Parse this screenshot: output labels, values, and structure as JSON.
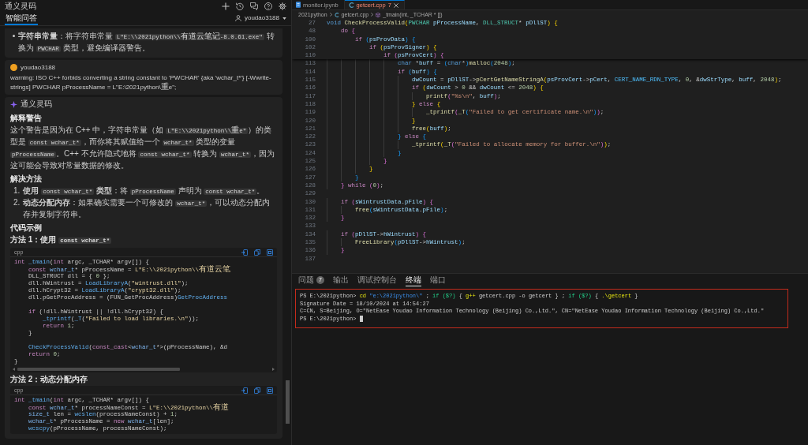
{
  "side_panel": {
    "title": "通义灵码",
    "tab": {
      "label": "智能问答",
      "selected": true
    },
    "user": "youdao3188"
  },
  "chat": [
    {
      "kind": "answer_tail",
      "blocks": [
        {
          "kind": "bullet",
          "segments": [
            {
              "kind": "bold",
              "text": "字符串常量"
            },
            {
              "kind": "text",
              "text": "：将字符串常量 "
            },
            {
              "kind": "code",
              "text": "L\"E:\\\\2021python\\\\有道云笔记-8.0.61.exe\""
            },
            {
              "kind": "text",
              "text": " 转换为 "
            },
            {
              "kind": "code",
              "text": "PWCHAR"
            },
            {
              "kind": "text",
              "text": " 类型，避免编译器警告。"
            }
          ]
        }
      ]
    },
    {
      "kind": "user",
      "author": "youdao3188",
      "text": "warning: ISO C++ forbids converting a string constant to 'PWCHAR' {aka 'wchar_t*'} [-Wwrite-strings] PWCHAR pProcessName = L\"E:\\2021python\\重e\";"
    },
    {
      "kind": "assistant",
      "author": "通义灵码",
      "blocks": [
        {
          "kind": "heading",
          "text": "解释警告"
        },
        {
          "kind": "paragraph",
          "segments": [
            {
              "kind": "text",
              "text": "这个警告是因为在 C++ 中，字符串常量（如 "
            },
            {
              "kind": "code",
              "text": "L\"E:\\\\2021python\\\\重e\""
            },
            {
              "kind": "text",
              "text": "）的类型是 "
            },
            {
              "kind": "code",
              "text": "const wchar_t*"
            },
            {
              "kind": "text",
              "text": "，而你将其赋值给一个 "
            },
            {
              "kind": "code",
              "text": "wchar_t*"
            },
            {
              "kind": "text",
              "text": " 类型的变量 "
            },
            {
              "kind": "code",
              "text": "pProcessName"
            },
            {
              "kind": "text",
              "text": "。C++ 不允许隐式地将 "
            },
            {
              "kind": "code",
              "text": "const wchar_t*"
            },
            {
              "kind": "text",
              "text": " 转换为 "
            },
            {
              "kind": "code",
              "text": "wchar_t*"
            },
            {
              "kind": "text",
              "text": "，因为这可能会导致对常量数据的修改。"
            }
          ]
        },
        {
          "kind": "heading",
          "text": "解决方法"
        },
        {
          "kind": "numbered",
          "marker": "1.",
          "segments": [
            {
              "kind": "bold",
              "text": "使用 "
            },
            {
              "kind": "code",
              "text": "const wchar_t*"
            },
            {
              "kind": "bold",
              "text": " 类型"
            },
            {
              "kind": "text",
              "text": "：将 "
            },
            {
              "kind": "code",
              "text": "pProcessName"
            },
            {
              "kind": "text",
              "text": " 声明为 "
            },
            {
              "kind": "code",
              "text": "const wchar_t*"
            },
            {
              "kind": "text",
              "text": "。"
            }
          ]
        },
        {
          "kind": "numbered",
          "marker": "2.",
          "segments": [
            {
              "kind": "bold",
              "text": "动态分配内存"
            },
            {
              "kind": "text",
              "text": "：如果确实需要一个可修改的 "
            },
            {
              "kind": "code",
              "text": "wchar_t*"
            },
            {
              "kind": "text",
              "text": "，可以动态分配内存并复制字符串。"
            }
          ]
        },
        {
          "kind": "heading",
          "text": "代码示例"
        },
        {
          "kind": "subheading",
          "segments": [
            {
              "kind": "text",
              "text": "方法 1：使用 "
            },
            {
              "kind": "code",
              "text": "const wchar_t*"
            }
          ]
        },
        {
          "kind": "code",
          "language": "cpp",
          "sections": [
            {
              "lines": [
                {
                  "tokens": [
                    {
                      "text": "int ",
                      "kind": "keyword"
                    },
                    {
                      "text": "_tmain",
                      "kind": "function"
                    },
                    {
                      "text": "(",
                      "kind": "plain"
                    },
                    {
                      "text": "int",
                      "kind": "keyword"
                    },
                    {
                      "text": " argc, _TCHAR* argv[]) {",
                      "kind": "plain"
                    }
                  ]
                },
                {
                  "tokens": [
                    {
                      "text": "    const ",
                      "kind": "keyword"
                    },
                    {
                      "text": "wchar_t",
                      "kind": "type"
                    },
                    {
                      "text": "* pProcessName = ",
                      "kind": "plain"
                    },
                    {
                      "text": "L\"E:\\\\2021python\\\\有道云笔",
                      "kind": "string"
                    }
                  ]
                },
                {
                  "tokens": [
                    {
                      "text": "    DLL_STRUCT dll = { ",
                      "kind": "plain"
                    },
                    {
                      "text": "0",
                      "kind": "number"
                    },
                    {
                      "text": " };",
                      "kind": "plain"
                    }
                  ]
                },
                {
                  "tokens": [
                    {
                      "text": "    dll.hWintrust = ",
                      "kind": "plain"
                    },
                    {
                      "text": "LoadLibraryA",
                      "kind": "function"
                    },
                    {
                      "text": "(",
                      "kind": "plain"
                    },
                    {
                      "text": "\"wintrust.dll\"",
                      "kind": "string"
                    },
                    {
                      "text": ");",
                      "kind": "plain"
                    }
                  ]
                },
                {
                  "tokens": [
                    {
                      "text": "    dll.hCrypt32 = ",
                      "kind": "plain"
                    },
                    {
                      "text": "LoadLibraryA",
                      "kind": "function"
                    },
                    {
                      "text": "(",
                      "kind": "plain"
                    },
                    {
                      "text": "\"crypt32.dll\"",
                      "kind": "string"
                    },
                    {
                      "text": ");",
                      "kind": "plain"
                    }
                  ]
                },
                {
                  "tokens": [
                    {
                      "text": "    dll.pGetProcAddress = (FUN_GetProcAddress)",
                      "kind": "plain"
                    },
                    {
                      "text": "GetProcAddress",
                      "kind": "function"
                    }
                  ]
                }
              ]
            },
            {
              "lines": [
                {
                  "tokens": [
                    {
                      "text": "    if",
                      "kind": "keyword"
                    },
                    {
                      "text": " (!dll.hWintrust || !dll.hCrypt32) {",
                      "kind": "plain"
                    }
                  ]
                },
                {
                  "tokens": [
                    {
                      "text": "        _tprintf",
                      "kind": "function"
                    },
                    {
                      "text": "(",
                      "kind": "plain"
                    },
                    {
                      "text": "_T",
                      "kind": "function"
                    },
                    {
                      "text": "(",
                      "kind": "plain"
                    },
                    {
                      "text": "\"Failed to load libraries.\\n\"",
                      "kind": "string"
                    },
                    {
                      "text": "));",
                      "kind": "plain"
                    }
                  ]
                },
                {
                  "tokens": [
                    {
                      "text": "        return ",
                      "kind": "keyword"
                    },
                    {
                      "text": "1",
                      "kind": "number"
                    },
                    {
                      "text": ";",
                      "kind": "plain"
                    }
                  ]
                },
                {
                  "tokens": [
                    {
                      "text": "    }",
                      "kind": "plain"
                    }
                  ]
                }
              ]
            },
            {
              "lines": [
                {
                  "tokens": [
                    {
                      "text": "    CheckProcessValid",
                      "kind": "function"
                    },
                    {
                      "text": "(",
                      "kind": "plain"
                    },
                    {
                      "text": "const_cast",
                      "kind": "keyword"
                    },
                    {
                      "text": "<",
                      "kind": "plain"
                    },
                    {
                      "text": "wchar_t",
                      "kind": "type"
                    },
                    {
                      "text": "*>(pProcessName), &d",
                      "kind": "plain"
                    }
                  ]
                },
                {
                  "tokens": [
                    {
                      "text": "    return ",
                      "kind": "keyword"
                    },
                    {
                      "text": "0",
                      "kind": "number"
                    },
                    {
                      "text": ";",
                      "kind": "plain"
                    }
                  ]
                },
                {
                  "tokens": [
                    {
                      "text": "}",
                      "kind": "plain"
                    }
                  ]
                }
              ]
            }
          ]
        },
        {
          "kind": "subheading",
          "segments": [
            {
              "kind": "text",
              "text": "方法 2：动态分配内存"
            }
          ]
        },
        {
          "kind": "code",
          "language": "cpp",
          "sections": [
            {
              "lines": [
                {
                  "tokens": [
                    {
                      "text": "int ",
                      "kind": "keyword"
                    },
                    {
                      "text": "_tmain",
                      "kind": "function"
                    },
                    {
                      "text": "(",
                      "kind": "plain"
                    },
                    {
                      "text": "int",
                      "kind": "keyword"
                    },
                    {
                      "text": " argc, _TCHAR* argv[]) {",
                      "kind": "plain"
                    }
                  ]
                },
                {
                  "tokens": [
                    {
                      "text": "    const ",
                      "kind": "keyword"
                    },
                    {
                      "text": "wchar_t",
                      "kind": "type"
                    },
                    {
                      "text": "* processNameConst = ",
                      "kind": "plain"
                    },
                    {
                      "text": "L\"E:\\\\2021python\\\\有道",
                      "kind": "string"
                    }
                  ]
                },
                {
                  "tokens": [
                    {
                      "text": "    size_t",
                      "kind": "type"
                    },
                    {
                      "text": " len = ",
                      "kind": "plain"
                    },
                    {
                      "text": "wcslen",
                      "kind": "function"
                    },
                    {
                      "text": "(processNameConst) + ",
                      "kind": "plain"
                    },
                    {
                      "text": "1",
                      "kind": "number"
                    },
                    {
                      "text": ";",
                      "kind": "plain"
                    }
                  ]
                },
                {
                  "tokens": [
                    {
                      "text": "    wchar_t",
                      "kind": "type"
                    },
                    {
                      "text": "* pProcessName = ",
                      "kind": "plain"
                    },
                    {
                      "text": "new ",
                      "kind": "keyword"
                    },
                    {
                      "text": "wchar_t",
                      "kind": "type"
                    },
                    {
                      "text": "[len];",
                      "kind": "plain"
                    }
                  ]
                },
                {
                  "tokens": [
                    {
                      "text": "    wcscpy",
                      "kind": "function"
                    },
                    {
                      "text": "(pProcessName, processNameConst);",
                      "kind": "plain"
                    }
                  ]
                }
              ]
            }
          ]
        }
      ]
    }
  ],
  "editor": {
    "tabs": [
      {
        "label": "monitor.ipynb",
        "kind": "notebook",
        "selected": false
      },
      {
        "label": "getcert.cpp",
        "kind": "cpp",
        "problems": "7",
        "selected": true
      }
    ],
    "breadcrumb": [
      {
        "text": "2021python",
        "kind": "folder"
      },
      {
        "text": "getcert.cpp",
        "kind": "file"
      },
      {
        "text": "_tmain(int, _TCHAR * [])",
        "kind": "function"
      }
    ],
    "sticky_lines": [
      {
        "number": "27",
        "tokens": [
          {
            "text": "void ",
            "kind": "keyword"
          },
          {
            "text": "CheckProcessValid",
            "kind": "function"
          },
          {
            "text": "(",
            "kind": "bracket1"
          },
          {
            "text": "PWCHAR ",
            "kind": "type"
          },
          {
            "text": "pProcessName",
            "kind": "variable"
          },
          {
            "text": ", ",
            "kind": "plain"
          },
          {
            "text": "DLL_STRUCT",
            "kind": "type"
          },
          {
            "text": "* ",
            "kind": "plain"
          },
          {
            "text": "pDllST",
            "kind": "variable"
          },
          {
            "text": ") ",
            "kind": "bracket1"
          },
          {
            "text": "{",
            "kind": "bracket1"
          }
        ]
      },
      {
        "number": "48",
        "tokens": [
          {
            "text": "    do ",
            "kind": "control"
          },
          {
            "text": "{",
            "kind": "bracket2"
          }
        ]
      },
      {
        "number": "100",
        "tokens": [
          {
            "text": "        if ",
            "kind": "control"
          },
          {
            "text": "(",
            "kind": "bracket3"
          },
          {
            "text": "psProvData",
            "kind": "variable"
          },
          {
            "text": ") ",
            "kind": "bracket3"
          },
          {
            "text": "{",
            "kind": "bracket3"
          }
        ]
      },
      {
        "number": "102",
        "tokens": [
          {
            "text": "            if ",
            "kind": "control"
          },
          {
            "text": "(",
            "kind": "bracket1"
          },
          {
            "text": "psProvSigner",
            "kind": "variable"
          },
          {
            "text": ") ",
            "kind": "bracket1"
          },
          {
            "text": "{",
            "kind": "bracket1"
          }
        ]
      },
      {
        "number": "110",
        "tokens": [
          {
            "text": "                if ",
            "kind": "control"
          },
          {
            "text": "(",
            "kind": "bracket2"
          },
          {
            "text": "psProvCert",
            "kind": "variable"
          },
          {
            "text": ") ",
            "kind": "bracket2"
          },
          {
            "text": "{",
            "kind": "bracket2"
          }
        ]
      }
    ],
    "lines": [
      {
        "number": "113",
        "tokens": [
          {
            "text": "                    char ",
            "kind": "keyword"
          },
          {
            "text": "*",
            "kind": "plain"
          },
          {
            "text": "buff",
            "kind": "variable"
          },
          {
            "text": " = ",
            "kind": "plain"
          },
          {
            "text": "(",
            "kind": "bracket3"
          },
          {
            "text": "char",
            "kind": "keyword"
          },
          {
            "text": "*",
            "kind": "plain"
          },
          {
            "text": ")",
            "kind": "bracket3"
          },
          {
            "text": "malloc",
            "kind": "function"
          },
          {
            "text": "(",
            "kind": "bracket3"
          },
          {
            "text": "2048",
            "kind": "number"
          },
          {
            "text": ")",
            "kind": "bracket3"
          },
          {
            "text": ";",
            "kind": "plain"
          }
        ]
      },
      {
        "number": "114",
        "tokens": [
          {
            "text": "                    if ",
            "kind": "control"
          },
          {
            "text": "(",
            "kind": "bracket3"
          },
          {
            "text": "buff",
            "kind": "variable"
          },
          {
            "text": ") ",
            "kind": "bracket3"
          },
          {
            "text": "{",
            "kind": "bracket3"
          }
        ]
      },
      {
        "number": "115",
        "tokens": [
          {
            "text": "                        dwCount",
            "kind": "variable"
          },
          {
            "text": " = ",
            "kind": "plain"
          },
          {
            "text": "pDllST",
            "kind": "variable"
          },
          {
            "text": "->",
            "kind": "plain"
          },
          {
            "text": "pCertGetNameStringA",
            "kind": "function"
          },
          {
            "text": "(",
            "kind": "bracket1"
          },
          {
            "text": "psProvCert",
            "kind": "variable"
          },
          {
            "text": "->",
            "kind": "plain"
          },
          {
            "text": "pCert",
            "kind": "variable"
          },
          {
            "text": ", ",
            "kind": "plain"
          },
          {
            "text": "CERT_NAME_RDN_TYPE",
            "kind": "constant"
          },
          {
            "text": ", ",
            "kind": "plain"
          },
          {
            "text": "0",
            "kind": "number"
          },
          {
            "text": ", &",
            "kind": "plain"
          },
          {
            "text": "dwStrType",
            "kind": "variable"
          },
          {
            "text": ", ",
            "kind": "plain"
          },
          {
            "text": "buff",
            "kind": "variable"
          },
          {
            "text": ", ",
            "kind": "plain"
          },
          {
            "text": "2048",
            "kind": "number"
          },
          {
            "text": ")",
            "kind": "bracket1"
          },
          {
            "text": ";",
            "kind": "plain"
          }
        ]
      },
      {
        "number": "116",
        "tokens": [
          {
            "text": "                        if ",
            "kind": "control"
          },
          {
            "text": "(",
            "kind": "bracket1"
          },
          {
            "text": "dwCount",
            "kind": "variable"
          },
          {
            "text": " > ",
            "kind": "plain"
          },
          {
            "text": "0",
            "kind": "number"
          },
          {
            "text": " && ",
            "kind": "plain"
          },
          {
            "text": "dwCount",
            "kind": "variable"
          },
          {
            "text": " <= ",
            "kind": "plain"
          },
          {
            "text": "2048",
            "kind": "number"
          },
          {
            "text": ") ",
            "kind": "bracket1"
          },
          {
            "text": "{",
            "kind": "bracket1"
          }
        ]
      },
      {
        "number": "117",
        "tokens": [
          {
            "text": "                            printf",
            "kind": "function"
          },
          {
            "text": "(",
            "kind": "bracket2"
          },
          {
            "text": "\"%s\\n\"",
            "kind": "string"
          },
          {
            "text": ", ",
            "kind": "plain"
          },
          {
            "text": "buff",
            "kind": "variable"
          },
          {
            "text": ")",
            "kind": "bracket2"
          },
          {
            "text": ";",
            "kind": "plain"
          }
        ]
      },
      {
        "number": "118",
        "tokens": [
          {
            "text": "                        }",
            "kind": "bracket1"
          },
          {
            "text": " else ",
            "kind": "control"
          },
          {
            "text": "{",
            "kind": "bracket1"
          }
        ]
      },
      {
        "number": "119",
        "tokens": [
          {
            "text": "                            _tprintf",
            "kind": "function"
          },
          {
            "text": "(",
            "kind": "bracket2"
          },
          {
            "text": "_T",
            "kind": "function"
          },
          {
            "text": "(",
            "kind": "bracket3"
          },
          {
            "text": "\"Failed to get certificate name.\\n\"",
            "kind": "string"
          },
          {
            "text": ")",
            "kind": "bracket3"
          },
          {
            "text": ")",
            "kind": "bracket2"
          },
          {
            "text": ";",
            "kind": "plain"
          }
        ]
      },
      {
        "number": "120",
        "tokens": [
          {
            "text": "                        }",
            "kind": "bracket1"
          }
        ]
      },
      {
        "number": "121",
        "tokens": [
          {
            "text": "                        free",
            "kind": "function"
          },
          {
            "text": "(",
            "kind": "bracket1"
          },
          {
            "text": "buff",
            "kind": "variable"
          },
          {
            "text": ")",
            "kind": "bracket1"
          },
          {
            "text": ";",
            "kind": "plain"
          }
        ]
      },
      {
        "number": "122",
        "tokens": [
          {
            "text": "                    }",
            "kind": "bracket3"
          },
          {
            "text": " else ",
            "kind": "control"
          },
          {
            "text": "{",
            "kind": "bracket3"
          }
        ]
      },
      {
        "number": "123",
        "tokens": [
          {
            "text": "                        _tprintf",
            "kind": "function"
          },
          {
            "text": "(",
            "kind": "bracket1"
          },
          {
            "text": "_T",
            "kind": "function"
          },
          {
            "text": "(",
            "kind": "bracket2"
          },
          {
            "text": "\"Failed to allocate memory for buffer.\\n\"",
            "kind": "string"
          },
          {
            "text": ")",
            "kind": "bracket2"
          },
          {
            "text": ")",
            "kind": "bracket1"
          },
          {
            "text": ";",
            "kind": "plain"
          }
        ]
      },
      {
        "number": "124",
        "tokens": [
          {
            "text": "                    }",
            "kind": "bracket3"
          }
        ]
      },
      {
        "number": "125",
        "tokens": [
          {
            "text": "                }",
            "kind": "bracket2"
          }
        ]
      },
      {
        "number": "126",
        "tokens": [
          {
            "text": "            }",
            "kind": "bracket1"
          }
        ]
      },
      {
        "number": "127",
        "tokens": [
          {
            "text": "        }",
            "kind": "bracket3"
          }
        ]
      },
      {
        "number": "128",
        "tokens": [
          {
            "text": "    }",
            "kind": "bracket2"
          },
          {
            "text": " while ",
            "kind": "control"
          },
          {
            "text": "(",
            "kind": "bracket2"
          },
          {
            "text": "0",
            "kind": "number"
          },
          {
            "text": ")",
            "kind": "bracket2"
          },
          {
            "text": ";",
            "kind": "plain"
          }
        ]
      },
      {
        "number": "129"
      },
      {
        "number": "130",
        "tokens": [
          {
            "text": "    if ",
            "kind": "control"
          },
          {
            "text": "(",
            "kind": "bracket2"
          },
          {
            "text": "sWintrustData",
            "kind": "variable"
          },
          {
            "text": ".",
            "kind": "plain"
          },
          {
            "text": "pFile",
            "kind": "variable"
          },
          {
            "text": ") ",
            "kind": "bracket2"
          },
          {
            "text": "{",
            "kind": "bracket2"
          }
        ]
      },
      {
        "number": "131",
        "tokens": [
          {
            "text": "        free",
            "kind": "function"
          },
          {
            "text": "(",
            "kind": "bracket3"
          },
          {
            "text": "sWintrustData",
            "kind": "variable"
          },
          {
            "text": ".",
            "kind": "plain"
          },
          {
            "text": "pFile",
            "kind": "variable"
          },
          {
            "text": ")",
            "kind": "bracket3"
          },
          {
            "text": ";",
            "kind": "plain"
          }
        ]
      },
      {
        "number": "132",
        "tokens": [
          {
            "text": "    }",
            "kind": "bracket2"
          }
        ]
      },
      {
        "number": "133"
      },
      {
        "number": "134",
        "tokens": [
          {
            "text": "    if ",
            "kind": "control"
          },
          {
            "text": "(",
            "kind": "bracket2"
          },
          {
            "text": "pDllST",
            "kind": "variable"
          },
          {
            "text": "->",
            "kind": "plain"
          },
          {
            "text": "hWintrust",
            "kind": "variable"
          },
          {
            "text": ") ",
            "kind": "bracket2"
          },
          {
            "text": "{",
            "kind": "bracket2"
          }
        ]
      },
      {
        "number": "135",
        "tokens": [
          {
            "text": "        FreeLibrary",
            "kind": "function"
          },
          {
            "text": "(",
            "kind": "bracket3"
          },
          {
            "text": "pDllST",
            "kind": "variable"
          },
          {
            "text": "->",
            "kind": "plain"
          },
          {
            "text": "hWintrust",
            "kind": "variable"
          },
          {
            "text": ")",
            "kind": "bracket3"
          },
          {
            "text": ";",
            "kind": "plain"
          }
        ]
      },
      {
        "number": "136",
        "tokens": [
          {
            "text": "    }",
            "kind": "bracket2"
          }
        ]
      },
      {
        "number": "137"
      }
    ]
  },
  "panel": {
    "tabs": [
      {
        "label": "问题",
        "count": "7",
        "selected": false
      },
      {
        "label": "输出",
        "selected": false
      },
      {
        "label": "调试控制台",
        "selected": false
      },
      {
        "label": "终端",
        "selected": true
      },
      {
        "label": "端口",
        "selected": false
      }
    ],
    "terminal": {
      "cursor": true,
      "lines": [
        {
          "tokens": [
            {
              "text": "PS E:\\2021python> ",
              "kind": "plain"
            },
            {
              "text": "cd",
              "kind": "command"
            },
            {
              "text": " \"e:\\2021python\\\"",
              "kind": "string"
            },
            {
              "text": " ; ",
              "kind": "plain"
            },
            {
              "text": "if ($?)",
              "kind": "keyword"
            },
            {
              "text": " { ",
              "kind": "plain"
            },
            {
              "text": "g++",
              "kind": "command"
            },
            {
              "text": " getcert.cpp -o getcert } ; ",
              "kind": "plain"
            },
            {
              "text": "if ($?)",
              "kind": "keyword"
            },
            {
              "text": " { ",
              "kind": "plain"
            },
            {
              "text": ".\\getcert",
              "kind": "command"
            },
            {
              "text": " }",
              "kind": "plain"
            }
          ]
        },
        {
          "tokens": [
            {
              "text": "Signature Date = 18/10/2024 at 14:54:27",
              "kind": "plain"
            }
          ]
        },
        {
          "tokens": [
            {
              "text": "C=CN, S=Beijing, O=\"NetEase Youdao Information Technology (Beijing) Co.,Ltd.\", CN=\"NetEase Youdao Information Technology (Beijing) Co.,Ltd.\"",
              "kind": "plain"
            }
          ]
        },
        {
          "tokens": [
            {
              "text": "PS E:\\2021python> ",
              "kind": "plain"
            }
          ]
        }
      ]
    }
  }
}
